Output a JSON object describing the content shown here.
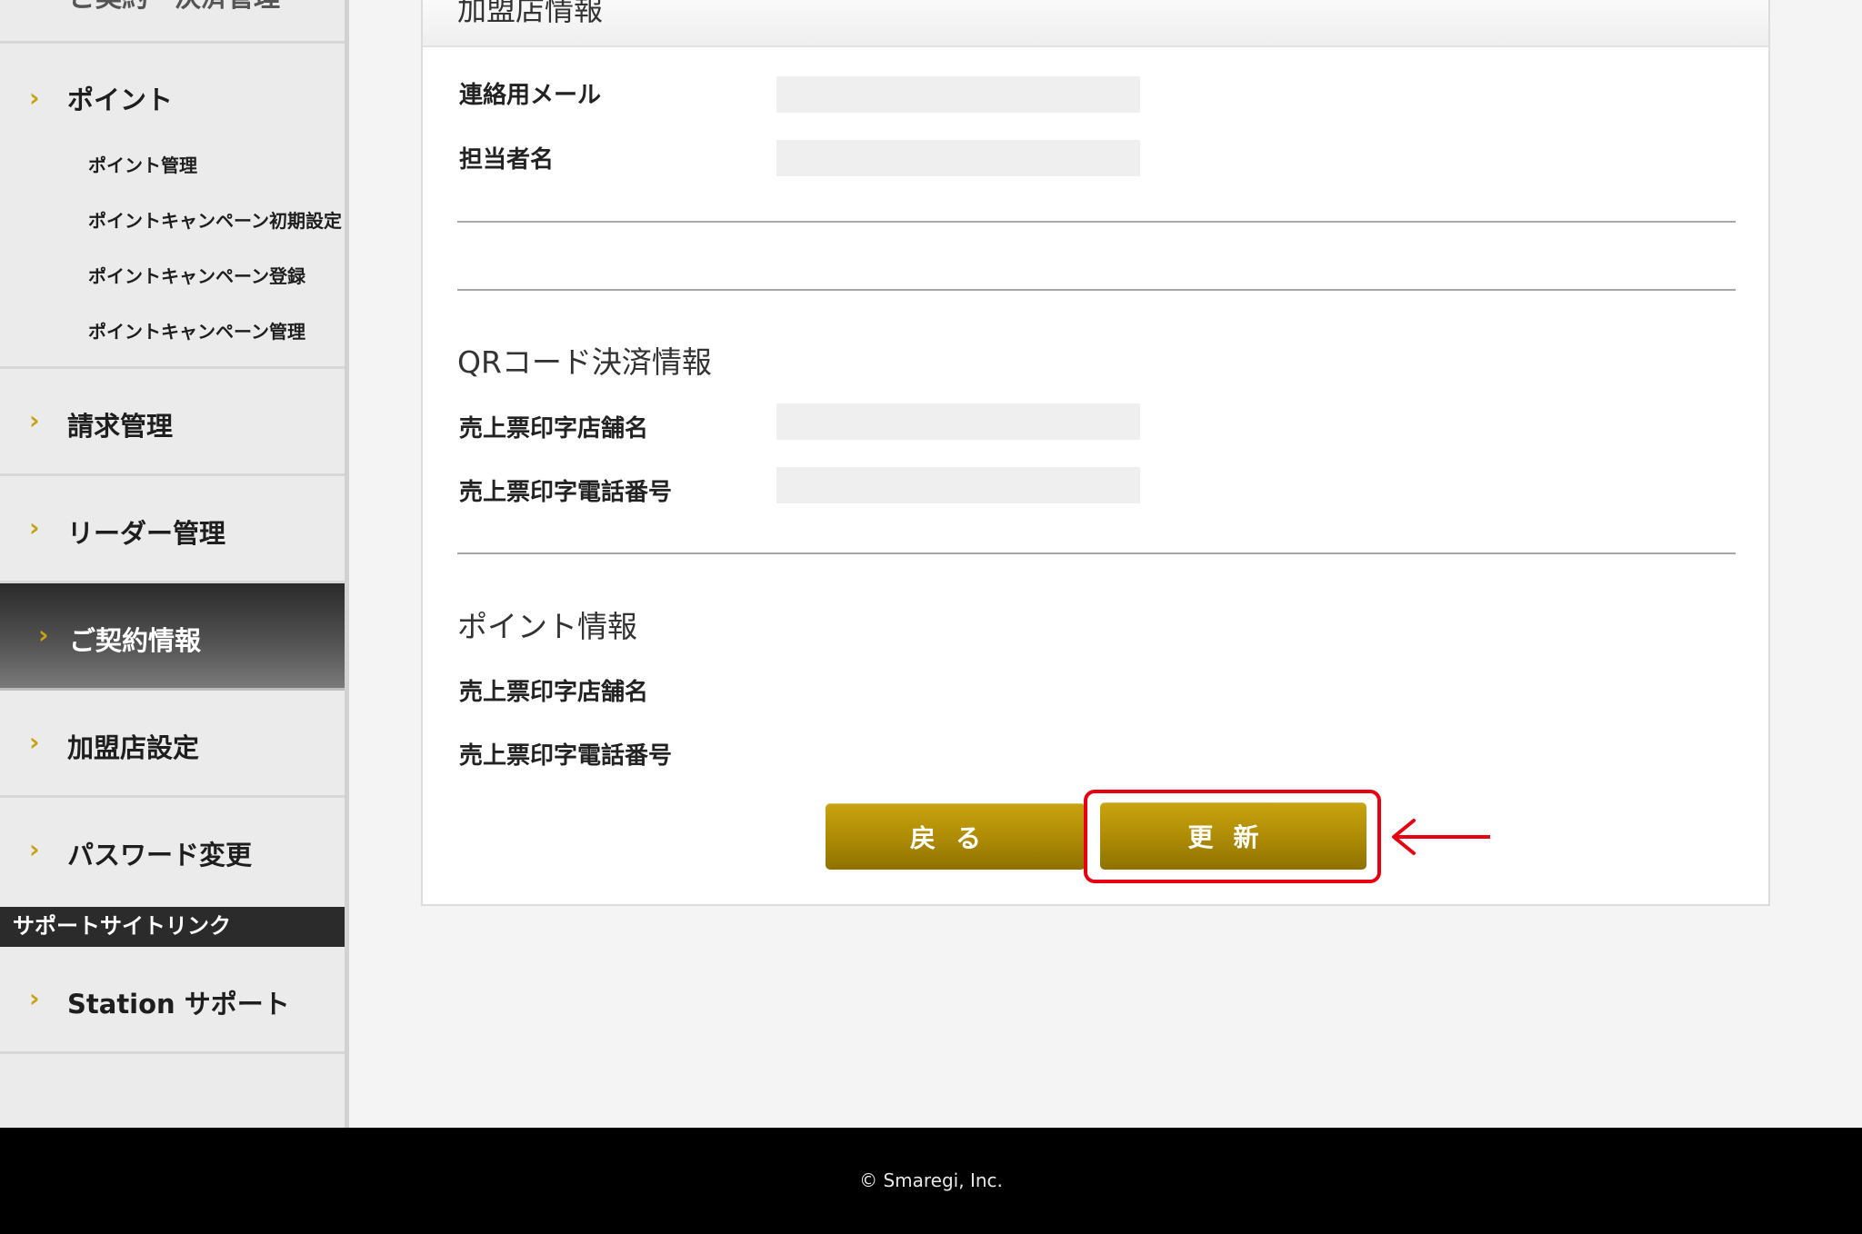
{
  "sidebar": {
    "top_partial_label": "ご契約・決済管理",
    "point_menu": {
      "label": "ポイント",
      "subitems": [
        "ポイント管理",
        "ポイントキャンペーン初期設定",
        "ポイントキャンペーン登録",
        "ポイントキャンペーン管理"
      ]
    },
    "items": [
      {
        "label": "請求管理"
      },
      {
        "label": "リーダー管理"
      },
      {
        "label": "ご契約情報",
        "active": true
      },
      {
        "label": "加盟店設定"
      },
      {
        "label": "パスワード変更"
      }
    ],
    "support_section_label": "サポートサイトリンク",
    "support_item": {
      "label": "Station サポート"
    },
    "chevron_icon": "chevron-right-icon",
    "accent_color": "#c9a212"
  },
  "card": {
    "title": "加盟店情報",
    "merchant_rows": [
      {
        "label": "連絡用メール",
        "value": ""
      },
      {
        "label": "担当者名",
        "value": ""
      }
    ],
    "qr_section": {
      "title": "QRコード決済情報",
      "rows": [
        {
          "label": "売上票印字店舗名",
          "value": ""
        },
        {
          "label": "売上票印字電話番号",
          "value": ""
        }
      ]
    },
    "point_section": {
      "title": "ポイント情報",
      "rows": [
        {
          "label": "売上票印字店舗名"
        },
        {
          "label": "売上票印字電話番号"
        }
      ]
    },
    "buttons": {
      "back_label": "戻る",
      "update_label": "更新"
    },
    "annotation": {
      "highlight_color": "#e60012",
      "arrow_icon": "arrow-left-icon"
    }
  },
  "footer": {
    "copyright": "© Smaregi, Inc."
  }
}
